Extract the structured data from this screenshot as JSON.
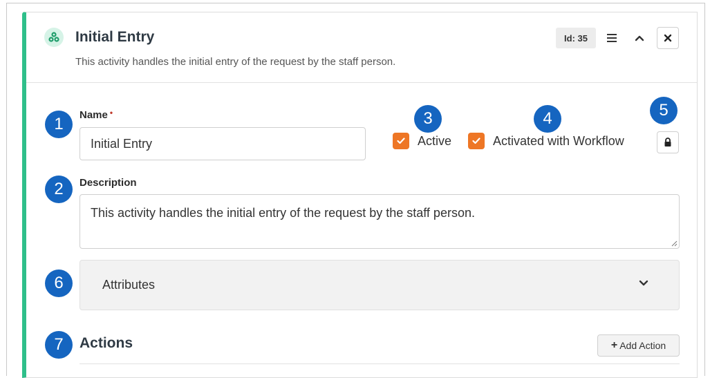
{
  "activity": {
    "title": "Initial Entry",
    "subtitle": "This activity handles the initial entry of the request by the staff person.",
    "id_badge": "Id: 35",
    "accent_color": "#2fbf8a"
  },
  "form": {
    "name_label": "Name",
    "name_required_marker": "•",
    "name_value": "Initial Entry",
    "description_label": "Description",
    "description_value": "This activity handles the initial entry of the request by the staff person.",
    "active_label": "Active",
    "active_checked": true,
    "activated_label": "Activated with Workflow",
    "activated_checked": true,
    "checkbox_color": "#ee7625"
  },
  "attributes": {
    "label": "Attributes"
  },
  "actions": {
    "title": "Actions",
    "add_plus": "+",
    "add_label": "Add Action"
  },
  "callouts": {
    "c1": "1",
    "c2": "2",
    "c3": "3",
    "c4": "4",
    "c5": "5",
    "c6": "6",
    "c7": "7",
    "color": "#1565c0"
  }
}
